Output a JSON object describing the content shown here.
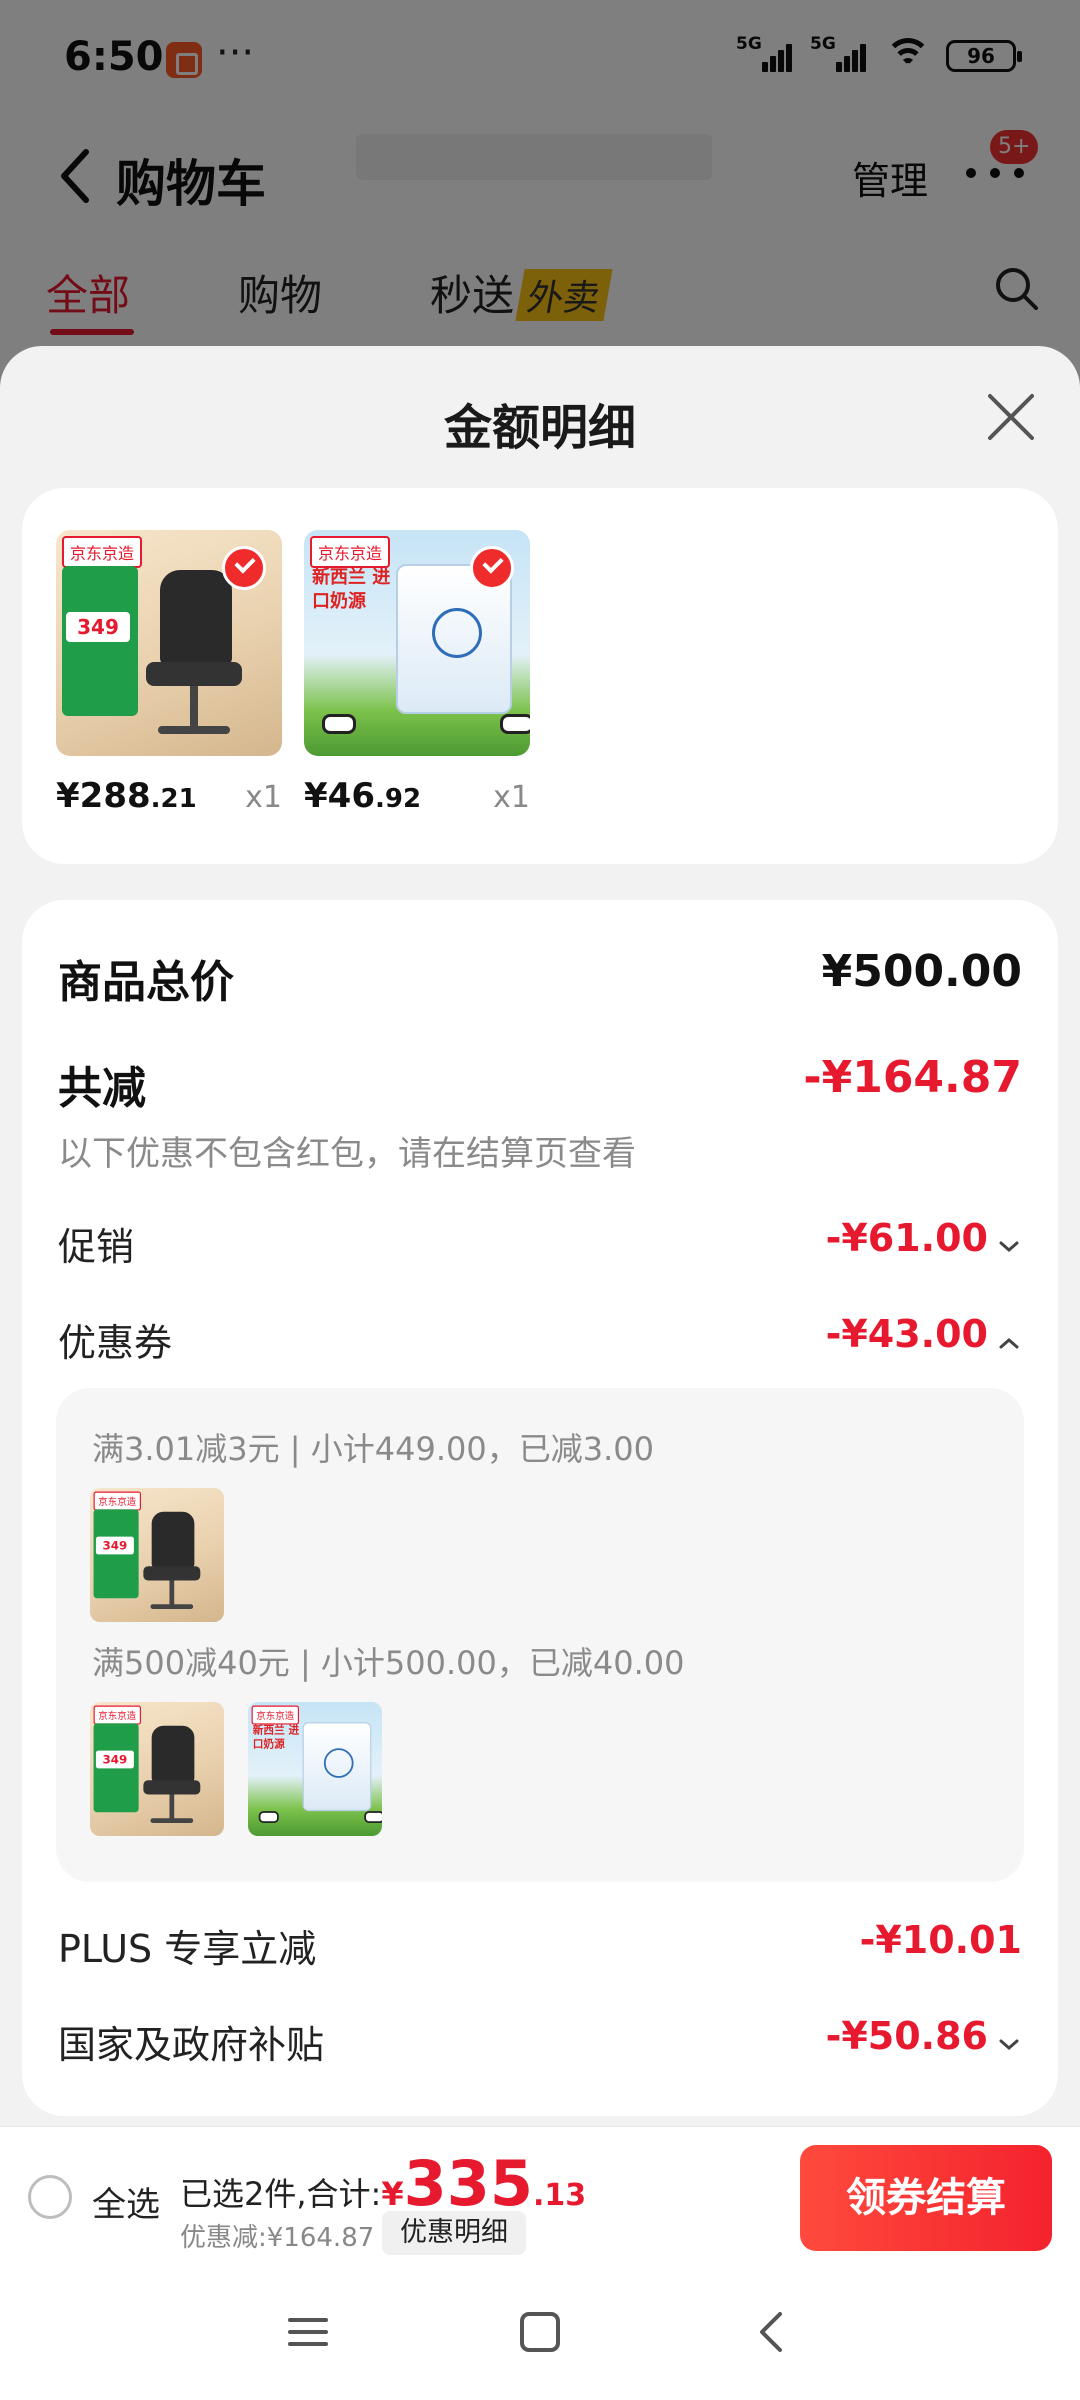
{
  "status_bar": {
    "time": "6:50",
    "more": "···",
    "signal1": "5G",
    "signal2": "5G",
    "battery": "96"
  },
  "header": {
    "title": "购物车",
    "manage": "管理",
    "badge": "5+"
  },
  "tabs": [
    {
      "label": "全部",
      "active": true
    },
    {
      "label": "购物"
    },
    {
      "label": "秒送",
      "tag": "外卖"
    }
  ],
  "sheet": {
    "title": "金额明细",
    "products": [
      {
        "name": "chair",
        "price_int": "¥288",
        "price_dec": ".21",
        "qty": "x1",
        "promo_price": "349",
        "brand": "京东京造"
      },
      {
        "name": "milk-powder",
        "price_int": "¥46",
        "price_dec": ".92",
        "qty": "x1",
        "brand": "京东京造",
        "title": "新西兰 进口奶源"
      }
    ],
    "total_label": "商品总价",
    "total_value": "¥500.00",
    "reduce_label": "共减",
    "reduce_value": "-¥164.87",
    "reduce_note": "以下优惠不包含红包，请在结算页查看",
    "promo_label": "促销",
    "promo_value": "-¥61.00",
    "coupon_label": "优惠券",
    "coupon_value": "-¥43.00",
    "coupon_rules": [
      {
        "text": "满3.01减3元 | 小计449.00，已减3.00"
      },
      {
        "text": "满500减40元 | 小计500.00，已减40.00"
      }
    ],
    "plus_label": "PLUS 专享立减",
    "plus_value": "-¥10.01",
    "gov_label": "国家及政府补贴",
    "gov_value": "-¥50.86"
  },
  "bottom_bar": {
    "select_all": "全选",
    "selected_text": "已选2件,合计:",
    "yen": "¥",
    "total_int": "335",
    "total_dec": ".13",
    "discount": "优惠减:¥164.87",
    "detail_pill": "优惠明细",
    "checkout": "领券结算"
  },
  "colors": {
    "accent": "#e6192e",
    "sheet_bg": "#f2f2f2"
  }
}
